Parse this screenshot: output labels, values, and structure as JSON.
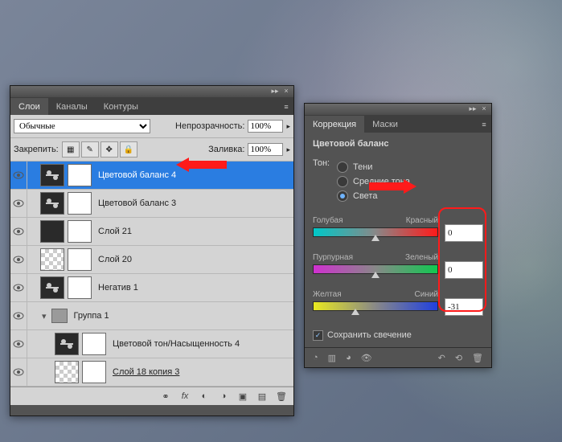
{
  "layers_panel": {
    "tabs": [
      "Слои",
      "Каналы",
      "Контуры"
    ],
    "active_tab": 0,
    "blend_label": "Обычные",
    "opacity_label": "Непрозрачность:",
    "opacity_value": "100%",
    "lock_label": "Закрепить:",
    "fill_label": "Заливка:",
    "fill_value": "100%",
    "layers": [
      {
        "name": "Цветовой баланс 4",
        "selected": true,
        "adj": true
      },
      {
        "name": "Цветовой баланс 3",
        "adj": true
      },
      {
        "name": "Слой 21"
      },
      {
        "name": "Слой 20",
        "checker": true
      },
      {
        "name": "Негатив 1",
        "adj": true
      },
      {
        "name": "Группа 1",
        "group": true
      },
      {
        "name": "Цветовой тон/Насыщенность 4",
        "adj": true,
        "indent": true
      },
      {
        "name": "Слой 18 копия 3",
        "indent": true,
        "underline": true,
        "checker": true
      }
    ]
  },
  "corrections_panel": {
    "tabs": [
      "Коррекция",
      "Маски"
    ],
    "active_tab": 0,
    "title": "Цветовой баланс",
    "tone_label": "Тон:",
    "tone_options": [
      "Тени",
      "Средние тона",
      "Света"
    ],
    "tone_selected": 2,
    "sliders": [
      {
        "left": "Голубая",
        "right": "Красный",
        "value": "0",
        "pos": 50,
        "cls": "sld-cr"
      },
      {
        "left": "Пурпурная",
        "right": "Зеленый",
        "value": "0",
        "pos": 50,
        "cls": "sld-mg"
      },
      {
        "left": "Желтая",
        "right": "Синий",
        "value": "-31",
        "pos": 34,
        "cls": "sld-yb"
      }
    ],
    "preserve_label": "Сохранить свечение",
    "preserve_checked": true
  }
}
